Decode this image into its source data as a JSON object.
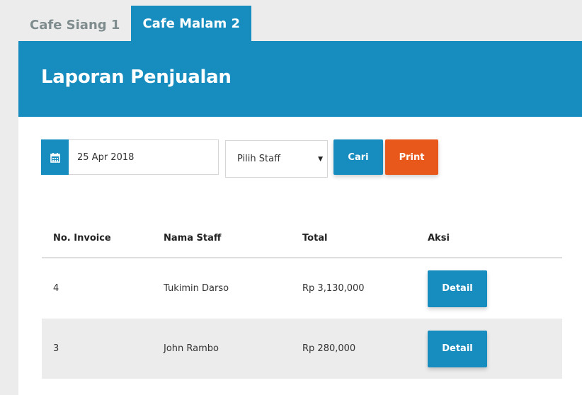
{
  "tabs": [
    {
      "label": "Cafe Siang 1",
      "active": false
    },
    {
      "label": "Cafe Malam 2",
      "active": true
    }
  ],
  "header": {
    "title": "Laporan Penjualan"
  },
  "filters": {
    "date_value": "25 Apr 2018",
    "staff_select": "Pilih Staff",
    "search_label": "Cari",
    "print_label": "Print"
  },
  "table": {
    "headers": [
      "No. Invoice",
      "Nama Staff",
      "Total",
      "Aksi"
    ],
    "rows": [
      {
        "invoice": "4",
        "staff": "Tukimin Darso",
        "total": "Rp 3,130,000",
        "action": "Detail"
      },
      {
        "invoice": "3",
        "staff": "John Rambo",
        "total": "Rp 280,000",
        "action": "Detail"
      }
    ]
  },
  "colors": {
    "primary": "#178cbe",
    "print": "#e8581a",
    "background": "#ececec"
  },
  "icons": {
    "date": "calendar-icon",
    "select": "caret-down-icon"
  }
}
